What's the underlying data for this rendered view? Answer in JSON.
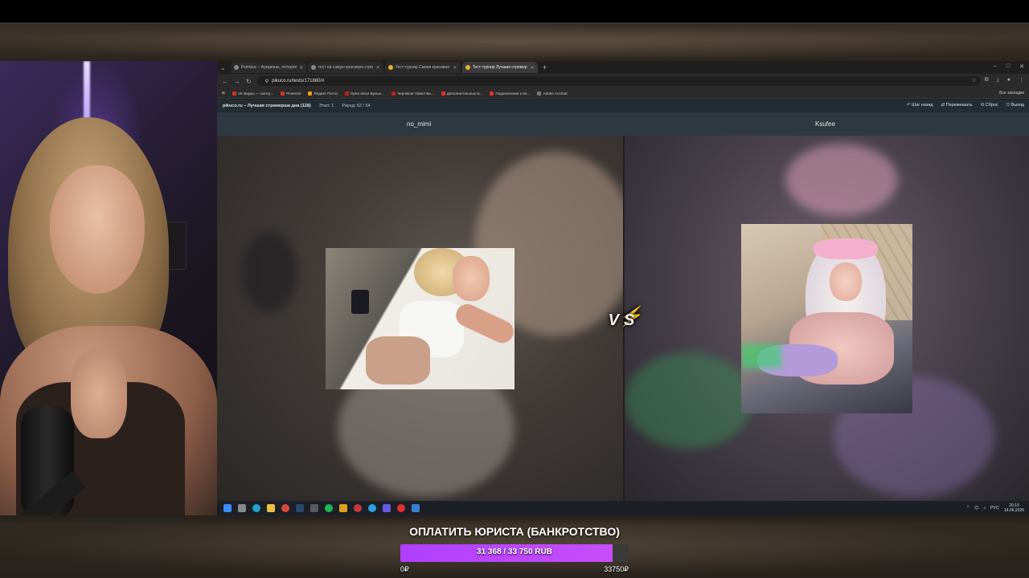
{
  "browser": {
    "tabs": [
      {
        "label": "Pointauc – Аукционы, лотерея"
      },
      {
        "label": "тест на самую красивую стри"
      },
      {
        "label": "Тест-турнир Самая красивая"
      },
      {
        "label": "Тест-турнир Лучшая стример"
      }
    ],
    "new_tab": "+",
    "url": "pikuco.ru/tests/171880/#"
  },
  "bookmarks": [
    {
      "label": "VK Видео — смотр..."
    },
    {
      "label": "Pinterest"
    },
    {
      "label": "Яндекс Почта"
    },
    {
      "label": "Орёл Илья Булын..."
    },
    {
      "label": "Черняков Павел Ва..."
    },
    {
      "label": "Дополнительные м..."
    },
    {
      "label": "Подключение к Se..."
    },
    {
      "label": "Adobe Acrobat"
    }
  ],
  "bookmarks_all": "Все закладки",
  "site": {
    "title": "pikuco.ru – Лучшая стримерша дна (128)",
    "stage": "Этап: 1",
    "round": "Раунд: 62 / 64",
    "actions": {
      "back": "Шаг назад",
      "shuffle": "Перемешать",
      "reset": "Сброс",
      "exit": "Выход"
    }
  },
  "contestants": {
    "left": "no_mimi",
    "right": "Ksufee"
  },
  "vs_label": "VS",
  "taskbar": {
    "lang": "РУС",
    "time": "20:19",
    "date": "14.06.2026"
  },
  "donation": {
    "title": "ОПЛАТИТЬ ЮРИСТА (БАНКРОТСТВО)",
    "progress_text": "31 368 / 33 750 RUB",
    "current": 31368,
    "goal": 33750,
    "min_label": "0₽",
    "max_label": "33750₽",
    "fill_color": "#c84dfa"
  }
}
